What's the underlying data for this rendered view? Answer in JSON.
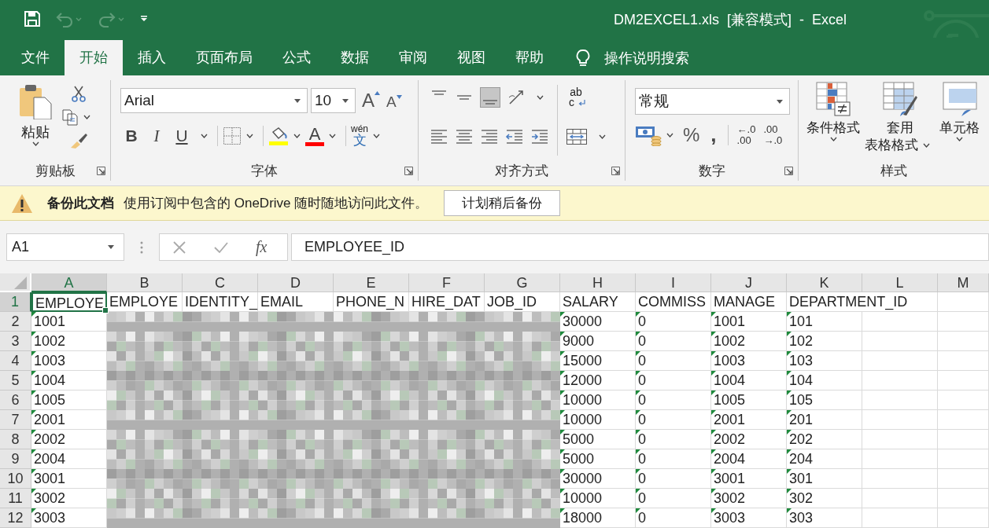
{
  "title_bar": {
    "title": "DM2EXCEL1.xls  [兼容模式]  -  Excel",
    "quick_access": [
      {
        "kind": "save",
        "disabled": false
      },
      {
        "kind": "undo",
        "disabled": true
      },
      {
        "kind": "redo",
        "disabled": true
      },
      {
        "kind": "customize",
        "disabled": false
      }
    ]
  },
  "ribbon_tabs": [
    {
      "label": "文件",
      "selected": false
    },
    {
      "label": "开始",
      "selected": true
    },
    {
      "label": "插入",
      "selected": false
    },
    {
      "label": "页面布局",
      "selected": false
    },
    {
      "label": "公式",
      "selected": false
    },
    {
      "label": "数据",
      "selected": false
    },
    {
      "label": "审阅",
      "selected": false
    },
    {
      "label": "视图",
      "selected": false
    },
    {
      "label": "帮助",
      "selected": false
    }
  ],
  "tell_me": "操作说明搜索",
  "ribbon": {
    "clipboard": {
      "paste": "粘贴",
      "label": "剪贴板"
    },
    "font": {
      "name": "Arial",
      "size": "10",
      "grow": "A",
      "shrink": "A",
      "bold": "B",
      "italic": "I",
      "underline": "U",
      "font_color": "A",
      "phonetic": [
        "wén",
        "文"
      ],
      "label": "字体"
    },
    "alignment": {
      "vertical": [
        {
          "kind": "top",
          "selected": false
        },
        {
          "kind": "middle",
          "selected": false
        },
        {
          "kind": "bottom",
          "selected": true
        }
      ],
      "wrap": [
        "ab",
        "c"
      ],
      "label": "对齐方式"
    },
    "number": {
      "format": "常规",
      "percent": "%",
      "comma": ",",
      "increase_decimal": [
        "←.0",
        ".00"
      ],
      "decrease_decimal": [
        ".00",
        "→.0"
      ],
      "label": "数字"
    },
    "styles": {
      "buttons": [
        {
          "kind": "conditional",
          "lines": [
            "条件格式"
          ]
        },
        {
          "kind": "table",
          "lines": [
            "套用",
            "表格格式"
          ]
        },
        {
          "kind": "cell",
          "lines": [
            "单元格"
          ]
        }
      ],
      "label": "样式"
    }
  },
  "message_bar": {
    "title": "备份此文档",
    "text": "使用订阅中包含的 OneDrive 随时随地访问此文件。",
    "button": "计划稍后备份"
  },
  "formula_bar": {
    "name_box": "A1",
    "fx": "fx",
    "value": "EMPLOYEE_ID"
  },
  "sheet": {
    "columns": [
      {
        "label": "A",
        "selected": true
      },
      {
        "label": "B",
        "selected": false
      },
      {
        "label": "C",
        "selected": false
      },
      {
        "label": "D",
        "selected": false
      },
      {
        "label": "E",
        "selected": false
      },
      {
        "label": "F",
        "selected": false
      },
      {
        "label": "G",
        "selected": false
      },
      {
        "label": "H",
        "selected": false
      },
      {
        "label": "I",
        "selected": false
      },
      {
        "label": "J",
        "selected": false
      },
      {
        "label": "K",
        "selected": false
      },
      {
        "label": "L",
        "selected": false
      },
      {
        "label": "M",
        "selected": false
      }
    ],
    "rows": [
      {
        "number": "1",
        "selected": true,
        "cells": [
          {
            "text": "EMPLOYE",
            "flag": false
          },
          {
            "text": "EMPLOYE",
            "flag": false
          },
          {
            "text": "IDENTITY_",
            "flag": false
          },
          {
            "text": "EMAIL",
            "flag": false
          },
          {
            "text": "PHONE_N",
            "flag": false
          },
          {
            "text": "HIRE_DAT",
            "flag": false
          },
          {
            "text": "JOB_ID",
            "flag": false
          },
          {
            "text": "SALARY",
            "flag": false
          },
          {
            "text": "COMMISS",
            "flag": false
          },
          {
            "text": "MANAGE",
            "flag": false
          },
          {
            "text": "DEPARTMENT_ID",
            "flag": false
          },
          null,
          null
        ]
      },
      {
        "number": "2",
        "selected": false,
        "cells": [
          {
            "text": "1001",
            "flag": true
          },
          null,
          null,
          null,
          null,
          null,
          null,
          {
            "text": "30000",
            "flag": true
          },
          {
            "text": "0",
            "flag": true
          },
          {
            "text": "1001",
            "flag": true
          },
          {
            "text": "101",
            "flag": true
          },
          null,
          null
        ]
      },
      {
        "number": "3",
        "selected": false,
        "cells": [
          {
            "text": "1002",
            "flag": true
          },
          null,
          null,
          null,
          null,
          null,
          null,
          {
            "text": "9000",
            "flag": true
          },
          {
            "text": "0",
            "flag": true
          },
          {
            "text": "1002",
            "flag": true
          },
          {
            "text": "102",
            "flag": true
          },
          null,
          null
        ]
      },
      {
        "number": "4",
        "selected": false,
        "cells": [
          {
            "text": "1003",
            "flag": true
          },
          null,
          null,
          null,
          null,
          null,
          null,
          {
            "text": "15000",
            "flag": true
          },
          {
            "text": "0",
            "flag": true
          },
          {
            "text": "1003",
            "flag": true
          },
          {
            "text": "103",
            "flag": true
          },
          null,
          null
        ]
      },
      {
        "number": "5",
        "selected": false,
        "cells": [
          {
            "text": "1004",
            "flag": true
          },
          null,
          null,
          null,
          null,
          null,
          null,
          {
            "text": "12000",
            "flag": true
          },
          {
            "text": "0",
            "flag": true
          },
          {
            "text": "1004",
            "flag": true
          },
          {
            "text": "104",
            "flag": true
          },
          null,
          null
        ]
      },
      {
        "number": "6",
        "selected": false,
        "cells": [
          {
            "text": "1005",
            "flag": true
          },
          null,
          null,
          null,
          null,
          null,
          null,
          {
            "text": "10000",
            "flag": true
          },
          {
            "text": "0",
            "flag": true
          },
          {
            "text": "1005",
            "flag": true
          },
          {
            "text": "105",
            "flag": true
          },
          null,
          null
        ]
      },
      {
        "number": "7",
        "selected": false,
        "cells": [
          {
            "text": "2001",
            "flag": true
          },
          null,
          null,
          null,
          null,
          null,
          null,
          {
            "text": "10000",
            "flag": true
          },
          {
            "text": "0",
            "flag": true
          },
          {
            "text": "2001",
            "flag": true
          },
          {
            "text": "201",
            "flag": true
          },
          null,
          null
        ]
      },
      {
        "number": "8",
        "selected": false,
        "cells": [
          {
            "text": "2002",
            "flag": true
          },
          null,
          null,
          null,
          null,
          null,
          null,
          {
            "text": "5000",
            "flag": true
          },
          {
            "text": "0",
            "flag": true
          },
          {
            "text": "2002",
            "flag": true
          },
          {
            "text": "202",
            "flag": true
          },
          null,
          null
        ]
      },
      {
        "number": "9",
        "selected": false,
        "cells": [
          {
            "text": "2004",
            "flag": true
          },
          null,
          null,
          null,
          null,
          null,
          null,
          {
            "text": "5000",
            "flag": true
          },
          {
            "text": "0",
            "flag": true
          },
          {
            "text": "2004",
            "flag": true
          },
          {
            "text": "204",
            "flag": true
          },
          null,
          null
        ]
      },
      {
        "number": "10",
        "selected": false,
        "cells": [
          {
            "text": "3001",
            "flag": true
          },
          null,
          null,
          null,
          null,
          null,
          null,
          {
            "text": "30000",
            "flag": true
          },
          {
            "text": "0",
            "flag": true
          },
          {
            "text": "3001",
            "flag": true
          },
          {
            "text": "301",
            "flag": true
          },
          null,
          null
        ]
      },
      {
        "number": "11",
        "selected": false,
        "cells": [
          {
            "text": "3002",
            "flag": true
          },
          null,
          null,
          null,
          null,
          null,
          null,
          {
            "text": "10000",
            "flag": true
          },
          {
            "text": "0",
            "flag": true
          },
          {
            "text": "3002",
            "flag": true
          },
          {
            "text": "302",
            "flag": true
          },
          null,
          null
        ]
      },
      {
        "number": "12",
        "selected": false,
        "cells": [
          {
            "text": "3003",
            "flag": true
          },
          null,
          null,
          null,
          null,
          null,
          null,
          {
            "text": "18000",
            "flag": true
          },
          {
            "text": "0",
            "flag": true
          },
          {
            "text": "3003",
            "flag": true
          },
          {
            "text": "303",
            "flag": true
          },
          null,
          null
        ]
      }
    ]
  }
}
